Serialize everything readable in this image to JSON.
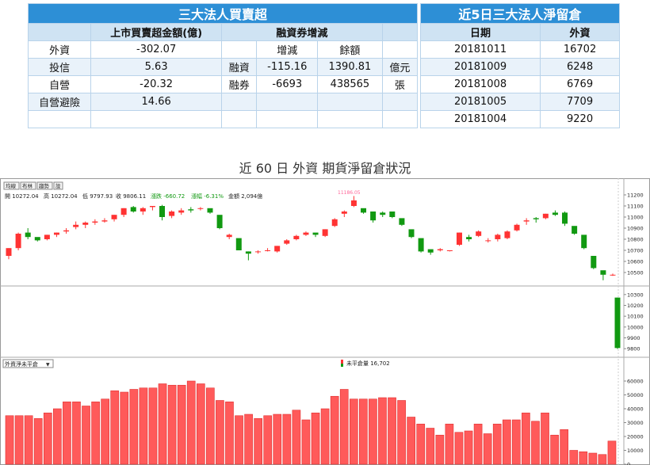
{
  "table_left": {
    "title": "三大法人買賣超",
    "header": [
      "",
      "上市買賣超金額(億)",
      "融資券增減",
      ""
    ],
    "rows": [
      [
        "外資",
        "-302.07",
        "",
        "增減",
        "餘額",
        ""
      ],
      [
        "投信",
        "5.63",
        "融資",
        "-115.16",
        "1390.81",
        "億元"
      ],
      [
        "自營",
        "-20.32",
        "融券",
        "-6693",
        "438565",
        "張"
      ],
      [
        "自營避險",
        "14.66",
        "",
        "",
        "",
        ""
      ],
      [
        "",
        "",
        "",
        "",
        "",
        ""
      ]
    ]
  },
  "table_right": {
    "title": "近5日三大法人淨留倉",
    "header": [
      "日期",
      "外資"
    ],
    "rows": [
      [
        "20181011",
        "16702"
      ],
      [
        "20181009",
        "6248"
      ],
      [
        "20181008",
        "6769"
      ],
      [
        "20181005",
        "7709"
      ],
      [
        "20181004",
        "9220"
      ]
    ]
  },
  "caption": "近 60 日 外資 期貨淨留倉狀況",
  "toolbar": {
    "buttons": [
      "均線",
      "布林",
      "趨勢",
      "設"
    ]
  },
  "info_line": {
    "open": "開 10272.04",
    "high": "高 10272.04",
    "low": "低 9797.93",
    "close": "收 9806.11",
    "change": "漲跌 -660.72",
    "pct": "漲幅 -6.31%",
    "amount": "金額 2,094億"
  },
  "peak_label": "11186.05",
  "bottom_dropdown": "外資淨未平倉",
  "bottom_legend": "未平倉量 16,702",
  "colors": {
    "up": "#ff3333",
    "down": "#119911",
    "bar": "#ff5a5a",
    "header": "#2d8fd6"
  },
  "chart_data": [
    {
      "type": "candlestick",
      "y_ticks": [
        10500,
        10600,
        10700,
        10800,
        10900,
        11000,
        11100,
        11200
      ],
      "ylim": [
        10400,
        11250
      ],
      "candles": [
        [
          10650,
          10720,
          10620,
          10720
        ],
        [
          10720,
          10860,
          10700,
          10850
        ],
        [
          10860,
          10900,
          10800,
          10820
        ],
        [
          10820,
          10800,
          10780,
          10790
        ],
        [
          10800,
          10840,
          10790,
          10840
        ],
        [
          10840,
          10860,
          10820,
          10860
        ],
        [
          10870,
          10900,
          10850,
          10880
        ],
        [
          10910,
          10960,
          10890,
          10930
        ],
        [
          10930,
          10960,
          10900,
          10950
        ],
        [
          10950,
          10980,
          10930,
          10960
        ],
        [
          10960,
          10990,
          10950,
          10970
        ],
        [
          10980,
          11020,
          10960,
          11020
        ],
        [
          11020,
          11080,
          11000,
          11080
        ],
        [
          11090,
          11100,
          11040,
          11050
        ],
        [
          11050,
          11090,
          11020,
          11080
        ],
        [
          11090,
          11100,
          11060,
          11100
        ],
        [
          11100,
          11110,
          10970,
          11000
        ],
        [
          11010,
          11060,
          10990,
          11050
        ],
        [
          11040,
          11080,
          11020,
          11060
        ],
        [
          11070,
          11090,
          11040,
          11060
        ],
        [
          11080,
          11090,
          11060,
          11080
        ],
        [
          11080,
          11070,
          11030,
          11040
        ],
        [
          11020,
          11000,
          10890,
          10900
        ],
        [
          10820,
          10850,
          10800,
          10840
        ],
        [
          10810,
          10800,
          10700,
          10700
        ],
        [
          10690,
          10690,
          10610,
          10670
        ],
        [
          10690,
          10700,
          10670,
          10690
        ],
        [
          10700,
          10720,
          10690,
          10700
        ],
        [
          10690,
          10740,
          10680,
          10740
        ],
        [
          10760,
          10800,
          10750,
          10790
        ],
        [
          10800,
          10840,
          10790,
          10830
        ],
        [
          10840,
          10870,
          10830,
          10860
        ],
        [
          10860,
          10850,
          10820,
          10840
        ],
        [
          10830,
          10890,
          10820,
          10890
        ],
        [
          10920,
          10990,
          10910,
          10980
        ],
        [
          11030,
          11060,
          11000,
          11050
        ],
        [
          11100,
          11190,
          11090,
          11150
        ],
        [
          11080,
          11070,
          11030,
          11040
        ],
        [
          11050,
          11040,
          10950,
          10970
        ],
        [
          11040,
          11050,
          11000,
          11020
        ],
        [
          11050,
          11040,
          10990,
          11000
        ],
        [
          10990,
          10960,
          10920,
          10930
        ],
        [
          10890,
          10880,
          10810,
          10820
        ],
        [
          10810,
          10800,
          10680,
          10690
        ],
        [
          10710,
          10700,
          10660,
          10680
        ],
        [
          10700,
          10720,
          10690,
          10710
        ],
        [
          10700,
          10700,
          10690,
          10700
        ],
        [
          10750,
          10860,
          10740,
          10860
        ],
        [
          10820,
          10840,
          10780,
          10800
        ],
        [
          10830,
          10880,
          10820,
          10870
        ],
        [
          10790,
          10810,
          10770,
          10790
        ],
        [
          10800,
          10850,
          10780,
          10840
        ],
        [
          10810,
          10880,
          10800,
          10870
        ],
        [
          10880,
          10940,
          10870,
          10930
        ],
        [
          10960,
          10990,
          10930,
          10970
        ],
        [
          10990,
          11000,
          10950,
          10980
        ],
        [
          10990,
          11030,
          10980,
          11030
        ],
        [
          11040,
          11060,
          11010,
          11020
        ],
        [
          11040,
          11050,
          10920,
          10940
        ],
        [
          10920,
          10910,
          10840,
          10850
        ],
        [
          10840,
          10830,
          10710,
          10720
        ],
        [
          10650,
          10640,
          10530,
          10540
        ],
        [
          10520,
          10510,
          10430,
          10480
        ],
        [
          10480,
          10490,
          10470,
          10480
        ]
      ]
    },
    {
      "type": "candlestick",
      "y_ticks": [
        9800,
        9900,
        10000,
        10100,
        10200,
        10300
      ],
      "ylim": [
        9750,
        10350
      ],
      "candles": [
        [
          10272.04,
          10272.04,
          9797.93,
          9806.11
        ]
      ]
    },
    {
      "type": "bar",
      "series": [
        {
          "name": "未平倉量",
          "values": [
            35000,
            35000,
            35000,
            33000,
            37000,
            40000,
            45000,
            45000,
            42000,
            45000,
            47000,
            53000,
            52000,
            54000,
            55000,
            55000,
            58000,
            57000,
            57000,
            60000,
            58000,
            55000,
            46000,
            45000,
            35000,
            36000,
            33000,
            35000,
            36000,
            36000,
            39000,
            32000,
            37000,
            40000,
            49000,
            54000,
            47000,
            47000,
            47000,
            48000,
            48000,
            46000,
            34000,
            29000,
            26000,
            21000,
            29000,
            23000,
            24000,
            29000,
            22000,
            29000,
            32000,
            32000,
            37000,
            31000,
            37000,
            21000,
            25000,
            10000,
            9000,
            8000,
            7000,
            16702
          ]
        }
      ],
      "y_ticks": [
        0,
        10000,
        20000,
        30000,
        40000,
        50000,
        60000
      ],
      "ylim": [
        0,
        68000
      ]
    }
  ]
}
